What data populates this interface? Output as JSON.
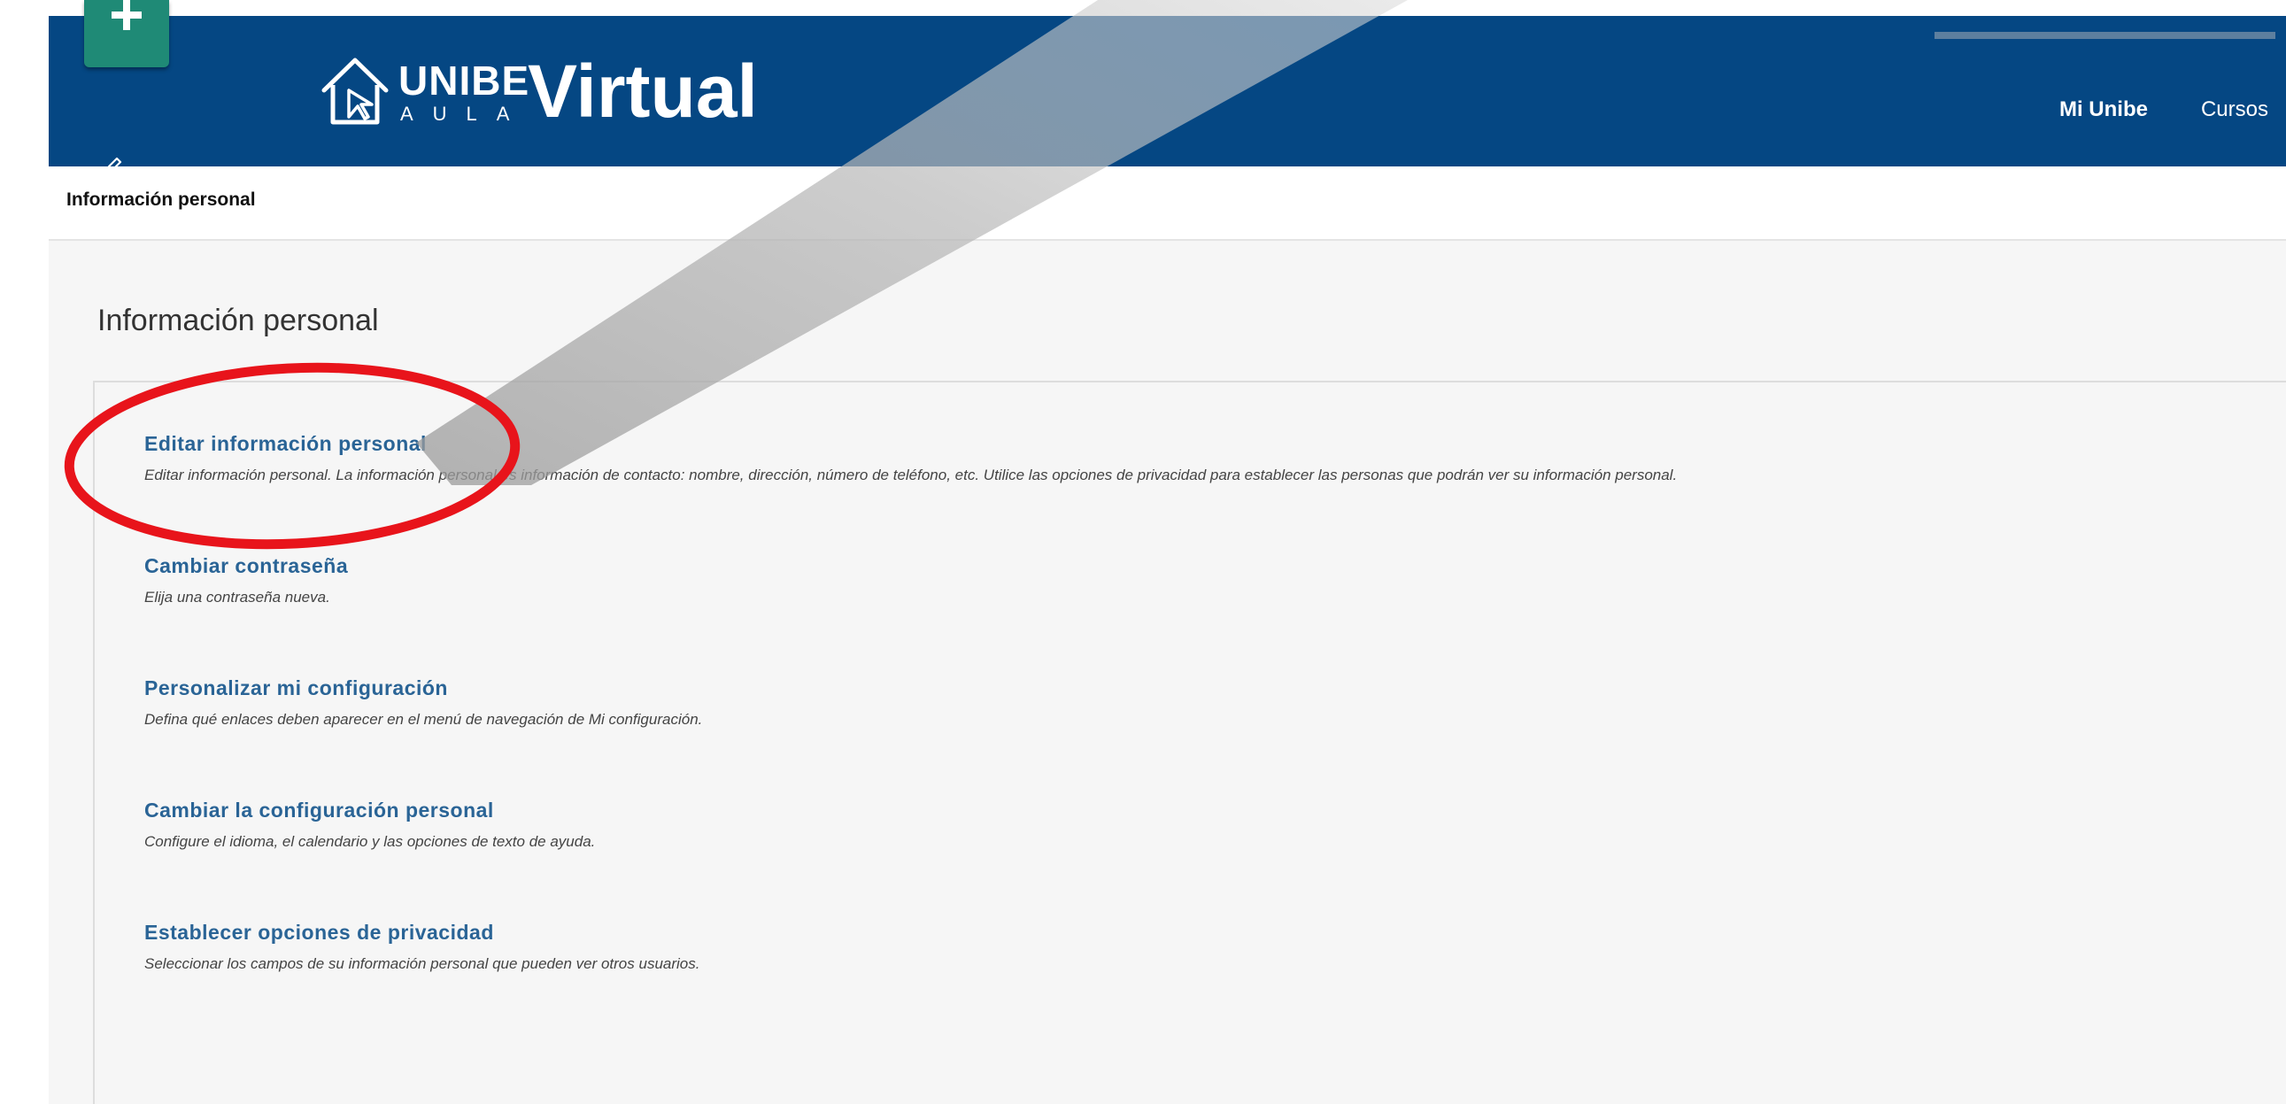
{
  "header": {
    "logo": {
      "unibe": "UNIBE",
      "aula": "AULA",
      "virtual": "Virtual"
    },
    "nav": [
      {
        "label": "Mi Unibe",
        "active": true
      },
      {
        "label": "Cursos",
        "active": false
      }
    ],
    "colors": {
      "header_bg": "#054783",
      "quick_add": "#1f8a76"
    }
  },
  "breadcrumb": {
    "current": "Información personal"
  },
  "main": {
    "title": "Información personal",
    "options": [
      {
        "title": "Editar información personal",
        "description": "Editar información personal. La información personal es información de contacto: nombre, dirección, número de teléfono, etc. Utilice las opciones de privacidad para establecer las personas que podrán ver su información personal."
      },
      {
        "title": "Cambiar contraseña",
        "description": "Elija una contraseña nueva."
      },
      {
        "title": "Personalizar mi configuración",
        "description": "Defina qué enlaces deben aparecer en el menú de navegación de Mi configuración."
      },
      {
        "title": "Cambiar la configuración personal",
        "description": "Configure el idioma, el calendario y las opciones de texto de ayuda."
      },
      {
        "title": "Establecer opciones de privacidad",
        "description": "Seleccionar los campos de su información personal que pueden ver otros usuarios."
      }
    ],
    "colors": {
      "link": "#2a6496",
      "highlight_ellipse": "#e8141b"
    }
  },
  "icons": {
    "quick_add": "plus-icon",
    "edit_mode": "pencil-icon",
    "logo_house": "house-icon"
  }
}
